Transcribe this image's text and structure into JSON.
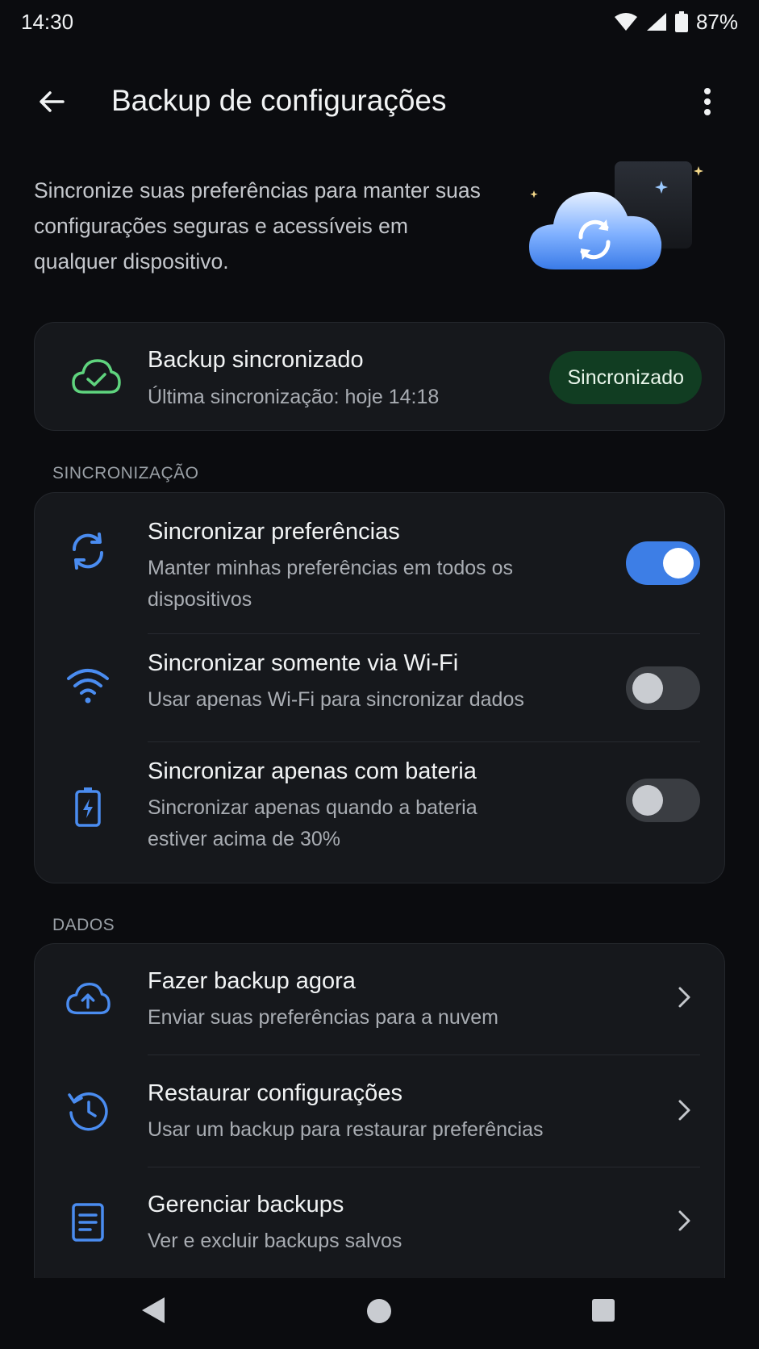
{
  "status_bar": {
    "time": "14:30",
    "battery": "87%"
  },
  "app_bar": {
    "title": "Backup de configurações"
  },
  "intro": {
    "text": "Sincronize suas preferências para manter suas configurações seguras e acessíveis em qualquer dispositivo."
  },
  "status_card": {
    "title": "Backup sincronizado",
    "subtitle": "Última sincronização: hoje 14:18",
    "chip": "Sincronizado",
    "icon": "cloud-check-icon",
    "accent": "#5fd47e"
  },
  "sync_section": {
    "label": "SINCRONIZAÇÃO",
    "items": [
      {
        "title": "Sincronizar preferências",
        "subtitle": "Manter minhas preferências em todos os dispositivos",
        "icon": "sync-icon",
        "enabled": true
      },
      {
        "title": "Sincronizar somente via Wi-Fi",
        "subtitle": "Usar apenas Wi-Fi para sincronizar dados",
        "icon": "wifi-icon",
        "enabled": false
      },
      {
        "title": "Sincronizar apenas com bateria",
        "subtitle": "Sincronizar apenas quando a bateria estiver acima de 30%",
        "icon": "battery-charging-icon",
        "enabled": false
      }
    ]
  },
  "data_section": {
    "label": "DADOS",
    "items": [
      {
        "title": "Fazer backup agora",
        "subtitle": "Enviar suas preferências para a nuvem",
        "icon": "cloud-upload-icon"
      },
      {
        "title": "Restaurar configurações",
        "subtitle": "Usar um backup para restaurar preferências",
        "icon": "restore-history-icon"
      },
      {
        "title": "Gerenciar backups",
        "subtitle": "Ver e excluir backups salvos",
        "icon": "document-list-icon"
      }
    ]
  },
  "colors": {
    "accent_blue": "#3d7ee6",
    "background": "#0b0c0f",
    "card": "#16181c",
    "chip_bg": "#113d22"
  }
}
